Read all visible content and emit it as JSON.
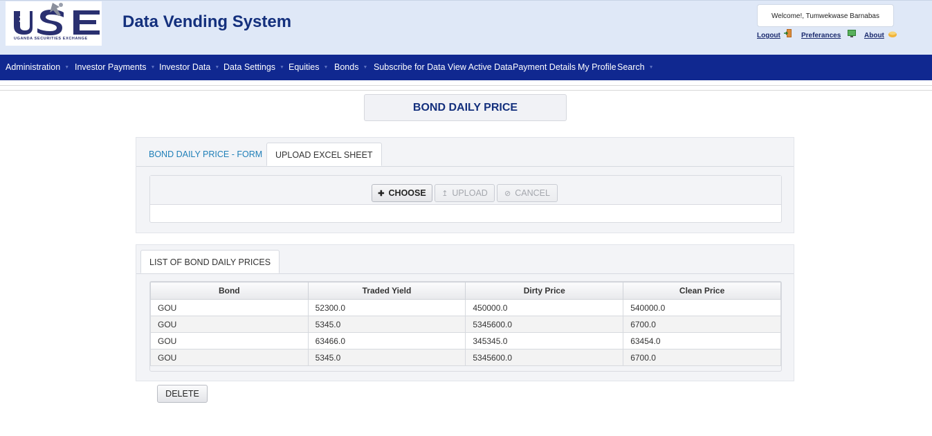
{
  "header": {
    "logo_text": "USE",
    "logo_caption": "UGANDA SECURITIES EXCHANGE",
    "app_title": "Data Vending System",
    "welcome": "Welcome!, Tumwekwase Barnabas",
    "links": {
      "logout": "Logout",
      "preferences": "Preferances",
      "about": "About"
    }
  },
  "nav": [
    {
      "label": "Administration",
      "caret": true
    },
    {
      "label": "Investor Payments",
      "caret": true
    },
    {
      "label": "Investor Data",
      "caret": true
    },
    {
      "label": "Data Settings",
      "caret": true
    },
    {
      "label": "Equities",
      "caret": true
    },
    {
      "label": "Bonds",
      "caret": true
    },
    {
      "label": "Subscribe for Data",
      "caret": false
    },
    {
      "label": "View Active Data",
      "caret": false
    },
    {
      "label": "Payment Details",
      "caret": false
    },
    {
      "label": "My Profile",
      "caret": false
    },
    {
      "label": "Search",
      "caret": true
    }
  ],
  "page_title": "BOND DAILY PRICE",
  "upload_panel": {
    "tabs": {
      "form": "BOND DAILY PRICE - FORM",
      "upload": "UPLOAD EXCEL SHEET"
    },
    "buttons": {
      "choose": "CHOOSE",
      "upload": "UPLOAD",
      "cancel": "CANCEL"
    }
  },
  "list_panel": {
    "tab": "LIST OF BOND DAILY PRICES",
    "columns": [
      "Bond",
      "Traded Yield",
      "Dirty Price",
      "Clean Price"
    ],
    "rows": [
      [
        "GOU",
        "52300.0",
        "450000.0",
        "540000.0"
      ],
      [
        "GOU",
        "5345.0",
        "5345600.0",
        "6700.0"
      ],
      [
        "GOU",
        "63466.0",
        "345345.0",
        "63454.0"
      ],
      [
        "GOU",
        "5345.0",
        "5345600.0",
        "6700.0"
      ]
    ]
  },
  "delete_label": "DELETE",
  "colors": {
    "nav_bg": "#102890",
    "header_bg": "#dfe8f7",
    "title_color": "#14307d",
    "tab_link": "#1f7fb8"
  }
}
